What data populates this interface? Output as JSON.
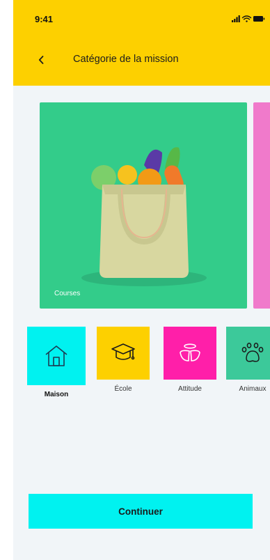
{
  "status_bar": {
    "time": "9:41"
  },
  "header": {
    "title": "Catégorie de la mission",
    "back_icon": "chevron-left-icon"
  },
  "carousel": {
    "cards": [
      {
        "label": "Courses",
        "image": "shopping-bag-with-vegetables",
        "color": "#33CC8A"
      },
      {
        "label": "",
        "image": "pink-card-partial",
        "color": "#F07ACB"
      }
    ]
  },
  "categories": [
    {
      "label": "Maison",
      "icon": "house-icon",
      "color": "#00F2F0",
      "selected": true
    },
    {
      "label": "École",
      "icon": "graduation-cap-icon",
      "color": "#FDD000",
      "selected": false
    },
    {
      "label": "Attitude",
      "icon": "halo-wings-icon",
      "color": "#FF1FA9",
      "selected": false
    },
    {
      "label": "Animaux",
      "icon": "paw-icon",
      "color": "#3CC99A",
      "selected": false
    }
  ],
  "continue_button": {
    "label": "Continuer",
    "color": "#00F2F0"
  },
  "colors": {
    "header": "#FDD000",
    "background": "#F1F5F8"
  }
}
